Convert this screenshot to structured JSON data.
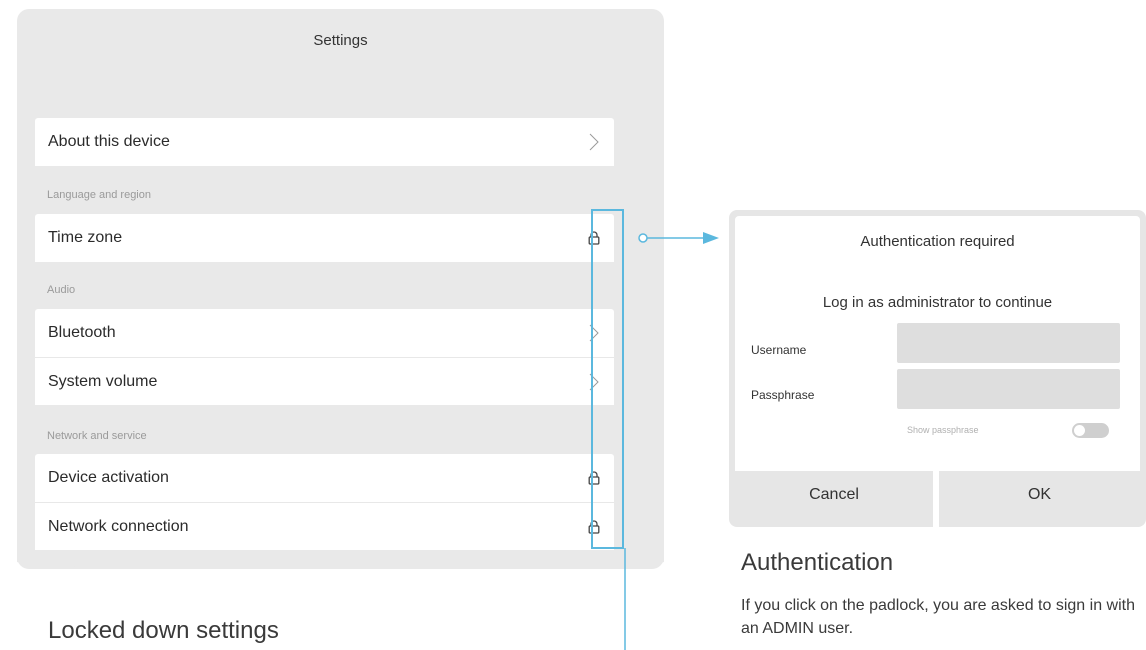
{
  "settings": {
    "title": "Settings",
    "about": "About this device",
    "sections": {
      "language": "Language and region",
      "audio": "Audio",
      "network": "Network and service"
    },
    "items": {
      "time_zone": "Time zone",
      "bluetooth": "Bluetooth",
      "system_volume": "System volume",
      "device_activation": "Device activation",
      "network_connection": "Network connection"
    }
  },
  "dialog": {
    "title": "Authentication required",
    "message": "Log in as administrator to continue",
    "username_label": "Username",
    "passphrase_label": "Passphrase",
    "show_passphrase": "Show passphrase",
    "cancel": "Cancel",
    "ok": "OK"
  },
  "captions": {
    "left_title": "Locked down settings",
    "right_title": "Authentication",
    "right_body": "If you click on the padlock, you are asked to sign in with an ADMIN user."
  },
  "colors": {
    "accent": "#5bb8de",
    "panel_bg": "#e9e9e9",
    "row_bg": "#ffffff"
  },
  "icons": {
    "chevron": "chevron-right-icon",
    "lock": "padlock-icon"
  }
}
